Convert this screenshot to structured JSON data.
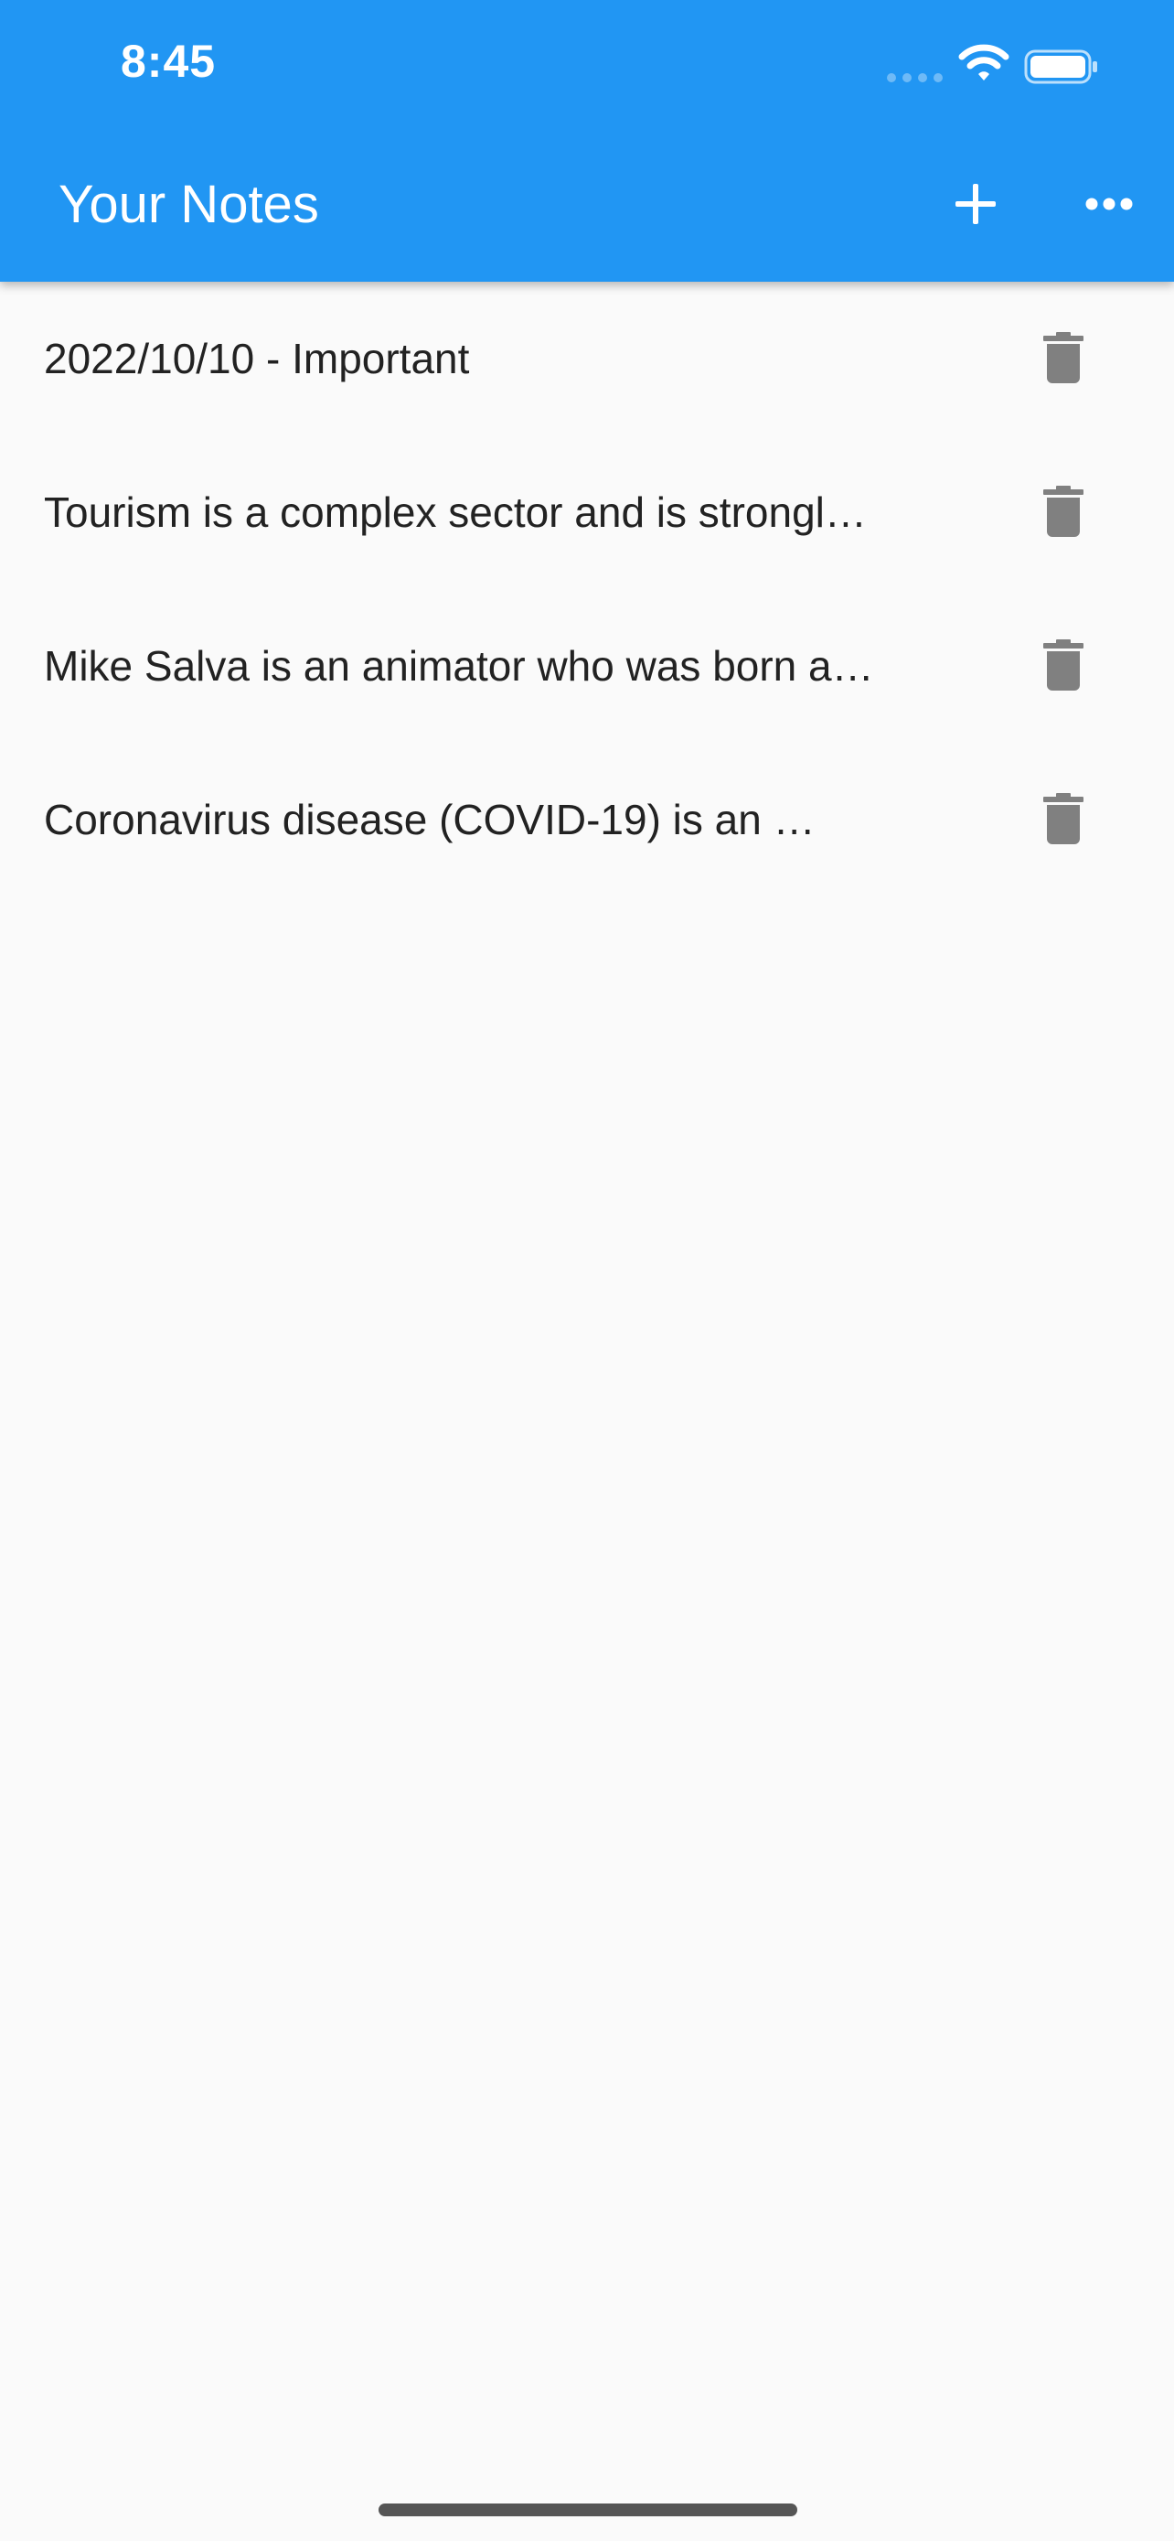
{
  "status_bar": {
    "time": "8:45"
  },
  "app_bar": {
    "title": "Your Notes",
    "color": "#2196f3",
    "add_icon": "plus-icon",
    "more_icon": "more-horizontal-icon"
  },
  "notes": [
    {
      "text": "2022/10/10 - Important",
      "delete_icon": "trash-icon"
    },
    {
      "text": "Tourism is a complex sector and is strongl…",
      "delete_icon": "trash-icon"
    },
    {
      "text": "Mike Salva is an animator who was born a…",
      "delete_icon": "trash-icon"
    },
    {
      "text": "Coronavirus disease (COVID-19) is an …",
      "delete_icon": "trash-icon"
    }
  ]
}
